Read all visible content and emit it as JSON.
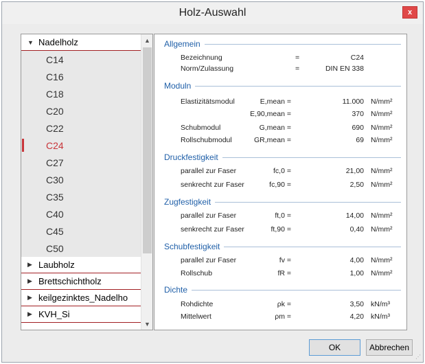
{
  "window": {
    "title": "Holz-Auswahl",
    "close_label": "x"
  },
  "tree": {
    "groups": [
      {
        "label": "Nadelholz",
        "expanded": true
      },
      {
        "label": "Laubholz",
        "expanded": false
      },
      {
        "label": "Brettschichtholz",
        "expanded": false
      },
      {
        "label": "keilgezinktes_Nadelho",
        "expanded": false
      },
      {
        "label": "KVH_Si",
        "expanded": false
      }
    ],
    "grades": [
      "C14",
      "C16",
      "C18",
      "C20",
      "C22",
      "C24",
      "C27",
      "C30",
      "C35",
      "C40",
      "C45",
      "C50"
    ],
    "selected_grade": "C24"
  },
  "sections": {
    "allgemein": {
      "title": "Allgemein",
      "rows": [
        {
          "name": "Bezeichnung",
          "eq": "=",
          "value": "C24"
        },
        {
          "name": "Norm/Zulassung",
          "eq": "=",
          "value": "DIN EN 338"
        }
      ]
    },
    "moduln": {
      "title": "Moduln",
      "rows": [
        {
          "name": "Elastizitätsmodul",
          "sym": "E,mean =",
          "value": "11.000",
          "unit": "N/mm²"
        },
        {
          "name": "",
          "sym": "E,90,mean =",
          "value": "370",
          "unit": "N/mm²"
        },
        {
          "name": "Schubmodul",
          "sym": "G,mean =",
          "value": "690",
          "unit": "N/mm²"
        },
        {
          "name": "Rollschubmodul",
          "sym": "GR,mean =",
          "value": "69",
          "unit": "N/mm²"
        }
      ]
    },
    "druck": {
      "title": "Druckfestigkeit",
      "rows": [
        {
          "name": "parallel zur Faser",
          "sym": "fc,0 =",
          "value": "21,00",
          "unit": "N/mm²"
        },
        {
          "name": "senkrecht zur Faser",
          "sym": "fc,90 =",
          "value": "2,50",
          "unit": "N/mm²"
        }
      ]
    },
    "zug": {
      "title": "Zugfestigkeit",
      "rows": [
        {
          "name": "parallel zur Faser",
          "sym": "ft,0 =",
          "value": "14,00",
          "unit": "N/mm²"
        },
        {
          "name": "senkrecht zur Faser",
          "sym": "ft,90 =",
          "value": "0,40",
          "unit": "N/mm²"
        }
      ]
    },
    "schub": {
      "title": "Schubfestigkeit",
      "rows": [
        {
          "name": "parallel zur Faser",
          "sym": "fv =",
          "value": "4,00",
          "unit": "N/mm²"
        },
        {
          "name": "Rollschub",
          "sym": "fR =",
          "value": "1,00",
          "unit": "N/mm²"
        }
      ]
    },
    "dichte": {
      "title": "Dichte",
      "rows": [
        {
          "name": "Rohdichte",
          "sym": "ρk =",
          "value": "3,50",
          "unit": "kN/m³"
        },
        {
          "name": "Mittelwert",
          "sym": "ρm =",
          "value": "4,20",
          "unit": "kN/m³"
        }
      ]
    }
  },
  "buttons": {
    "ok": "OK",
    "cancel": "Abbrechen"
  },
  "icons": {
    "expanded": "triangle-down-icon",
    "collapsed": "triangle-right-icon"
  },
  "colors": {
    "selected": "#c8353a",
    "section": "#1f5fa8",
    "close": "#e04848"
  }
}
